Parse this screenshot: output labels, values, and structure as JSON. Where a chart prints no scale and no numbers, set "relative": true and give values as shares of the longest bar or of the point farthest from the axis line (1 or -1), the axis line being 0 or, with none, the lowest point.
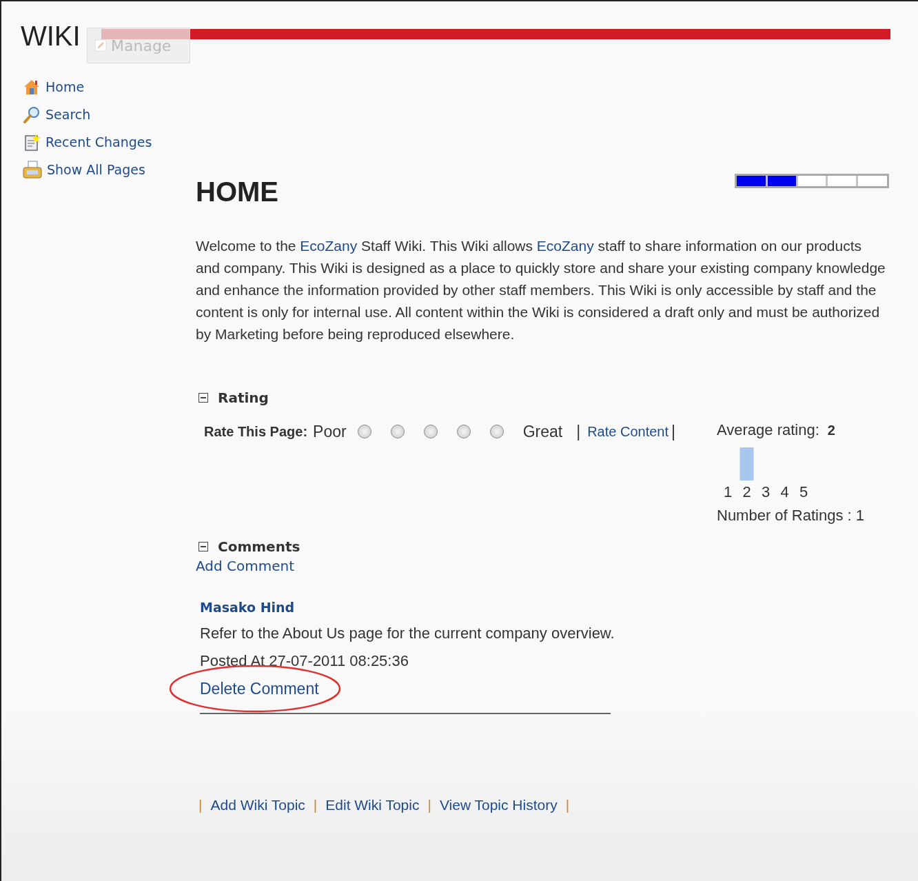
{
  "header": {
    "title": "WIKI",
    "manage_button": "Manage"
  },
  "nav": [
    {
      "label": "Home"
    },
    {
      "label": "Search"
    },
    {
      "label": "Recent Changes"
    },
    {
      "label": "Show All Pages"
    }
  ],
  "page": {
    "title": "HOME",
    "rating_meter": {
      "level": 0.4
    },
    "intro": [
      {
        "kind": "text",
        "text": "Welcome to the "
      },
      {
        "kind": "link",
        "text": "EcoZany"
      },
      {
        "kind": "text",
        "text": " Staff Wiki. This Wiki allows "
      },
      {
        "kind": "link",
        "text": "EcoZany"
      },
      {
        "kind": "text",
        "text": " staff to share information on our products and company. This Wiki is designed as a place to quickly store and share your existing company knowledge and enhance the information provided by other staff members. This Wiki is only accessible by staff and the content is only for internal use. All content within the Wiki is considered a draft only and must be authorized by Marketing before being reproduced elsewhere."
      }
    ]
  },
  "rating": {
    "heading": "Rating",
    "expanded": true,
    "prompt": "Rate This Page:",
    "low_label": "Poor",
    "high_label": "Great",
    "options": [
      {
        "selected": false
      },
      {
        "selected": false
      },
      {
        "selected": false
      },
      {
        "selected": false
      },
      {
        "selected": false
      }
    ],
    "separator_left": "|",
    "rate_link": "Rate Content",
    "separator_right": "|",
    "average_label": "Average rating:",
    "average_value": "2",
    "chart_data": {
      "type": "bar",
      "relative": true,
      "categories": [
        "1",
        "2",
        "3",
        "4",
        "5"
      ],
      "values": [
        0,
        1,
        0,
        0,
        0
      ]
    },
    "count_text": "Number of Ratings : 1"
  },
  "comments": {
    "heading": "Comments",
    "expanded": true,
    "add_link": "Add Comment",
    "items": [
      {
        "author": "Masako Hind",
        "text": "Refer to the About Us page for the current company overview.",
        "posted": "Posted At 27-07-2011 08:25:36",
        "delete_link": "Delete Comment",
        "highlighted": true
      }
    ]
  },
  "footer_links": [
    "Add Wiki Topic",
    "Edit Wiki Topic",
    "View Topic History"
  ],
  "footer_separator": "|"
}
